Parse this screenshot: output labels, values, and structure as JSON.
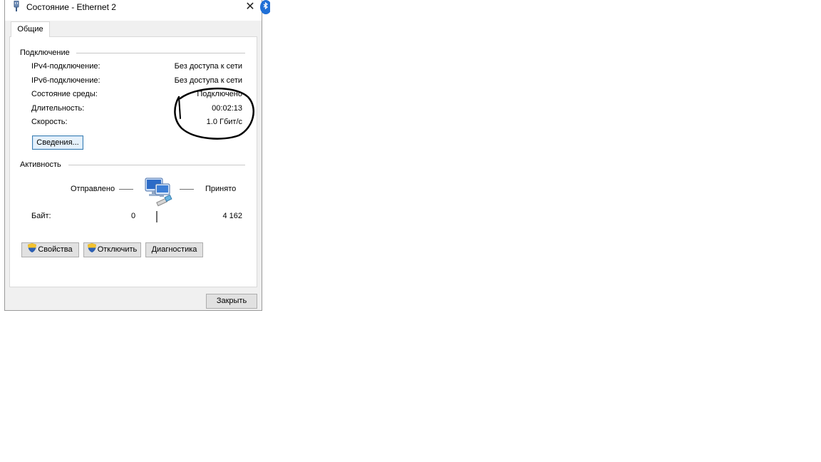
{
  "window": {
    "title": "Состояние - Ethernet 2",
    "close_glyph": "✕"
  },
  "tabs": [
    {
      "label": "Общие"
    }
  ],
  "connection": {
    "title": "Подключение",
    "rows": [
      {
        "label": "IPv4-подключение:",
        "value": "Без доступа к сети"
      },
      {
        "label": "IPv6-подключение:",
        "value": "Без доступа к сети"
      },
      {
        "label": "Состояние среды:",
        "value": "Подключено"
      },
      {
        "label": "Длительность:",
        "value": "00:02:13"
      },
      {
        "label": "Скорость:",
        "value": "1.0 Гбит/с"
      }
    ],
    "details_button": "Сведения..."
  },
  "activity": {
    "title": "Активность",
    "sent_label": "Отправлено",
    "received_label": "Принято",
    "bytes_label": "Байт:",
    "bytes_sent": "0",
    "bytes_received": "4 162"
  },
  "buttons": {
    "properties": "Свойства",
    "disable": "Отключить",
    "diagnose": "Диагностика",
    "close": "Закрыть"
  },
  "icons": {
    "title": "ethernet-connector-icon",
    "network": "network-computers-icon",
    "shield": "uac-shield-icon",
    "bluetooth": "bluetooth-icon"
  },
  "colors": {
    "dialog_bg": "#f0f0f0",
    "panel_bg": "#ffffff",
    "focus_border": "#3c7fb1",
    "annotation": "#000000"
  }
}
